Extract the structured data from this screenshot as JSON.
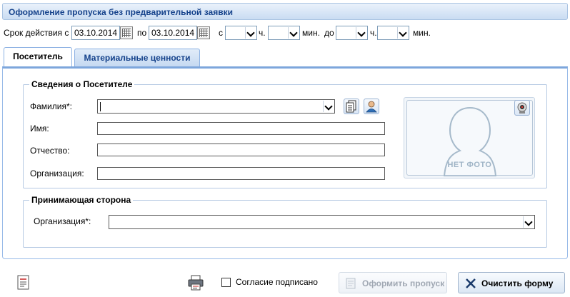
{
  "header": {
    "title": "Оформление пропуска без предварительной заявки"
  },
  "validity": {
    "label": "Срок действия с",
    "from_date": "03.10.2014",
    "to_label": "по",
    "to_date": "03.10.2014",
    "time_from_label": "с",
    "hours_label": "ч.",
    "minutes_label": "мин.",
    "time_to_label": "до",
    "hours_label_2": "ч.",
    "minutes_label_2": "мин."
  },
  "tabs": [
    {
      "label": "Посетитель",
      "active": true
    },
    {
      "label": "Материальные ценности",
      "active": false
    }
  ],
  "visitor": {
    "legend": "Сведения о Посетителе",
    "surname_label": "Фамилия*:",
    "surname_value": "",
    "name_label": "Имя:",
    "patronymic_label": "Отчество:",
    "organization_label": "Организация:",
    "no_photo_text": "НЕТ ФОТО"
  },
  "host": {
    "legend": "Принимающая сторона",
    "organization_label": "Организация*:",
    "organization_value": ""
  },
  "footer": {
    "consent_label": "Согласие подписано",
    "consent_checked": false,
    "issue_label": "Оформить пропуск",
    "clear_label": "Очистить форму"
  },
  "colors": {
    "accent": "#15428b",
    "tab_border": "#7da6dc",
    "clear_icon": "#1a3a6b"
  },
  "icons": {
    "copy": "document-copy-icon",
    "person": "person-lookup-icon",
    "webcam": "webcam-icon",
    "report": "report-document-icon",
    "print": "printer-icon",
    "issue": "pass-document-icon",
    "clear": "clear-x-icon"
  }
}
